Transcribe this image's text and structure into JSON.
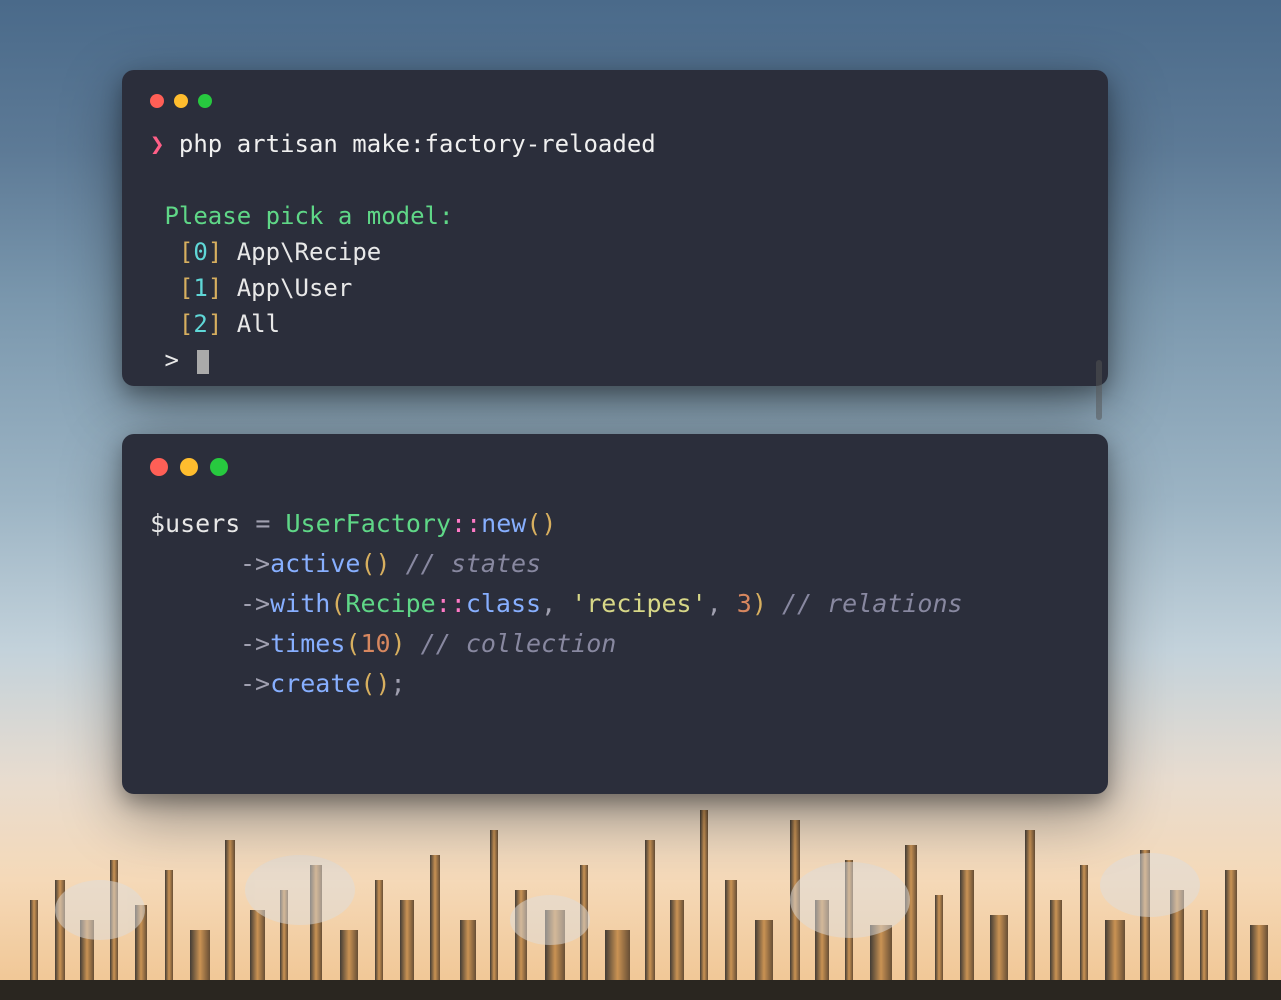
{
  "terminal1": {
    "prompt_symbol": "❯",
    "command": "php artisan make:factory-reloaded",
    "prompt_header": "Please pick a model:",
    "options": [
      {
        "idx": "0",
        "label": "App\\Recipe"
      },
      {
        "idx": "1",
        "label": "App\\User"
      },
      {
        "idx": "2",
        "label": "All"
      }
    ],
    "input_prompt": ">"
  },
  "terminal2": {
    "line1": {
      "var": "$users",
      "eq": " = ",
      "class": "UserFactory",
      "dbl": "::",
      "method": "new",
      "paren": "()"
    },
    "line2": {
      "arrow": "->",
      "method": "active",
      "paren": "()",
      "comment": " // states"
    },
    "line3": {
      "arrow": "->",
      "method": "with",
      "open": "(",
      "argclass": "Recipe",
      "dbl": "::",
      "classkw": "class",
      "comma1": ", ",
      "str": "'recipes'",
      "comma2": ", ",
      "num": "3",
      "close": ")",
      "comment": " // relations"
    },
    "line4": {
      "arrow": "->",
      "method": "times",
      "open": "(",
      "num": "10",
      "close": ")",
      "comment": " // collection"
    },
    "line5": {
      "arrow": "->",
      "method": "create",
      "paren": "()",
      "semi": ";"
    }
  }
}
